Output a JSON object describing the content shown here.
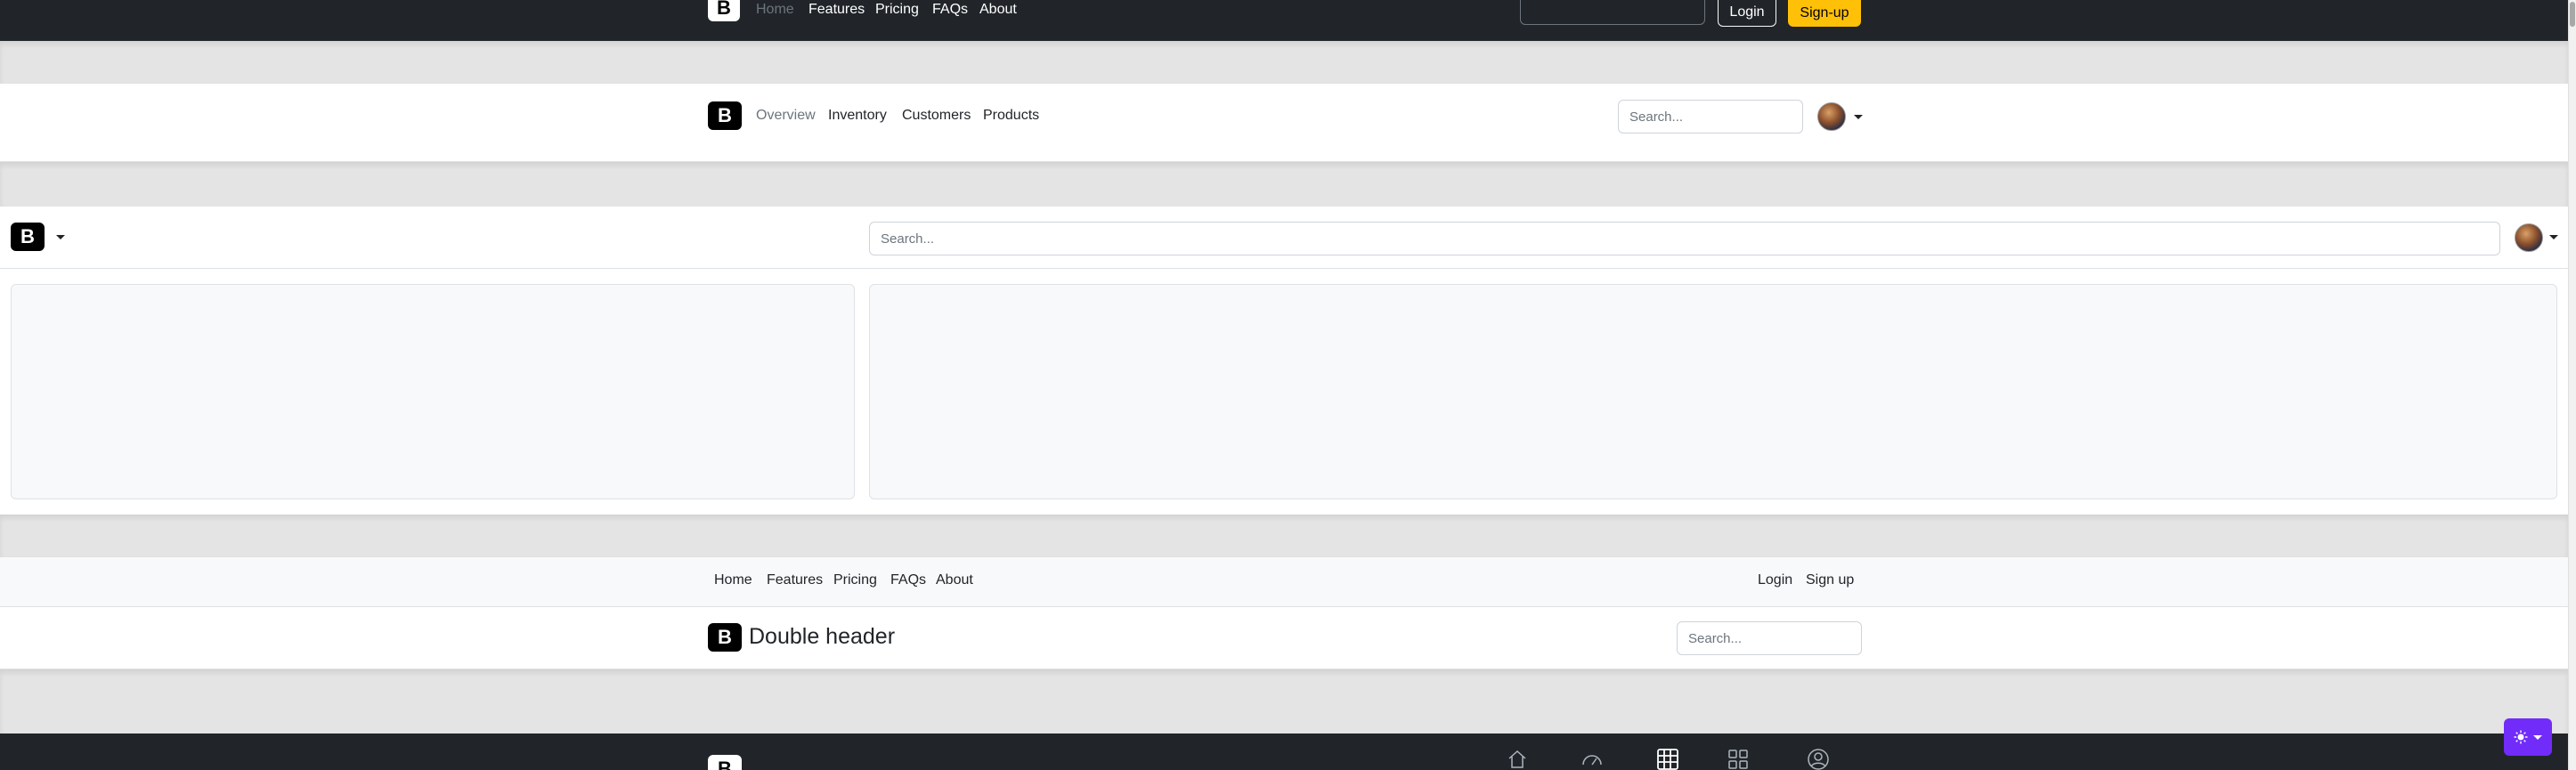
{
  "header1": {
    "logo": "B",
    "nav": [
      "Home",
      "Features",
      "Pricing",
      "FAQs",
      "About"
    ],
    "login": "Login",
    "signup": "Sign-up"
  },
  "header2": {
    "logo": "B",
    "nav": [
      "Overview",
      "Inventory",
      "Customers",
      "Products"
    ],
    "search_placeholder": "Search..."
  },
  "header3": {
    "logo": "B",
    "search_placeholder": "Search..."
  },
  "header4": {
    "nav": [
      "Home",
      "Features",
      "Pricing",
      "FAQs",
      "About"
    ],
    "login": "Login",
    "signup": "Sign up",
    "logo": "B",
    "title": "Double header",
    "search_placeholder": "Search..."
  },
  "header5": {
    "logo": "B",
    "icons": [
      "home-icon",
      "speedometer-icon",
      "table-icon",
      "grid-icon",
      "person-circle-icon"
    ]
  },
  "theme_toggle": {
    "icon": "sun-icon"
  },
  "colors": {
    "dark": "#212529",
    "warning": "#ffc107",
    "accent": "#712cf9",
    "muted": "#6c757d"
  }
}
